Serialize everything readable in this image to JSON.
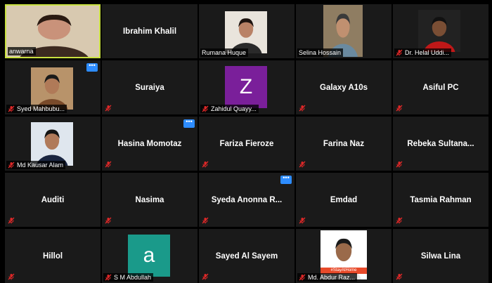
{
  "colors": {
    "background": "#000000",
    "tile": "#1a1a1a",
    "active_speaker_border": "#c8e040",
    "more_button": "#2d8cff",
    "muted_icon": "#e02828",
    "avatar_purple": "#7a1f9a",
    "avatar_teal": "#1a9a8a"
  },
  "icons": {
    "muted": "mic-off-icon",
    "more": "more-options-icon"
  },
  "participants": [
    {
      "name": "anwarna",
      "video": true,
      "speaking": true,
      "muted": false
    },
    {
      "name": "Ibrahim Khalil",
      "video": false,
      "muted": false
    },
    {
      "name": "Rumana Huque",
      "video": true,
      "muted": false
    },
    {
      "name": "Selina Hossain",
      "video": true,
      "muted": false
    },
    {
      "name": "Dr. Helal Uddi...",
      "video": true,
      "muted": true
    },
    {
      "name": "Syed Mahbubu...",
      "video": true,
      "muted": true,
      "more_button": true
    },
    {
      "name": "Suraiya",
      "video": false,
      "muted": true
    },
    {
      "name": "Zahidul Quayy...",
      "avatar_letter": "Z",
      "muted": true
    },
    {
      "name": "Galaxy A10s",
      "video": false,
      "muted": true
    },
    {
      "name": "Asiful PC",
      "video": false,
      "muted": true
    },
    {
      "name": "Md Kausar Alam",
      "video": true,
      "muted": true
    },
    {
      "name": "Hasina Momotaz",
      "video": false,
      "muted": true,
      "more_button": true
    },
    {
      "name": "Fariza Fieroze",
      "video": false,
      "muted": true
    },
    {
      "name": "Farina Naz",
      "video": false,
      "muted": true
    },
    {
      "name": "Rebeka  Sultana...",
      "video": false,
      "muted": true
    },
    {
      "name": "Auditi",
      "video": false,
      "muted": true
    },
    {
      "name": "Nasima",
      "video": false,
      "muted": true
    },
    {
      "name": "Syeda  Anonna  R...",
      "video": false,
      "muted": true,
      "more_button": true
    },
    {
      "name": "Emdad",
      "video": false,
      "muted": true
    },
    {
      "name": "Tasmia Rahman",
      "video": false,
      "muted": true
    },
    {
      "name": "Hillol",
      "video": false,
      "muted": true
    },
    {
      "name": "S M Abdullah",
      "avatar_letter": "a",
      "muted": true
    },
    {
      "name": "Sayed Al Sayem",
      "video": false,
      "muted": true
    },
    {
      "name": "Md. Abdur Raz...",
      "video": true,
      "muted": true,
      "banner": "#StayAtHome"
    },
    {
      "name": "Silwa Lina",
      "video": false,
      "muted": true
    }
  ]
}
